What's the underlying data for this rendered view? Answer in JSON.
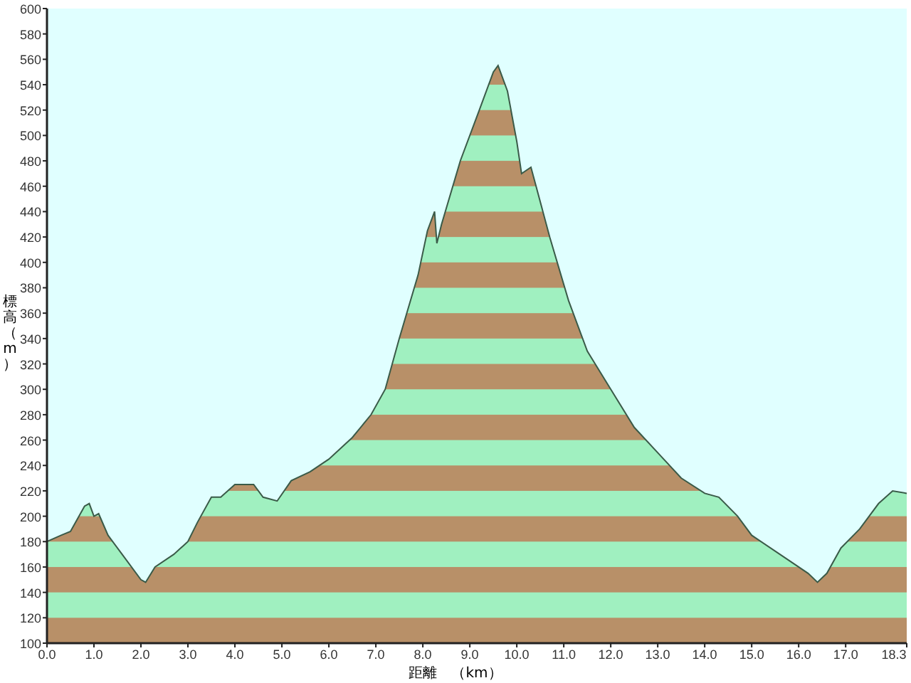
{
  "chart": {
    "chart_data": {
      "type": "area",
      "xlabel": "距離　（km）",
      "ylabel": "標高（m）",
      "x": [
        0,
        0.3,
        0.5,
        0.8,
        0.9,
        1.0,
        1.1,
        1.3,
        1.6,
        2.0,
        2.1,
        2.3,
        2.7,
        3.0,
        3.2,
        3.5,
        3.7,
        4.0,
        4.4,
        4.6,
        4.9,
        5.2,
        5.6,
        6.0,
        6.5,
        6.9,
        7.2,
        7.5,
        7.9,
        8.1,
        8.25,
        8.3,
        8.4,
        8.8,
        9.2,
        9.5,
        9.6,
        9.8,
        10.0,
        10.1,
        10.3,
        10.7,
        11.1,
        11.5,
        12.0,
        12.5,
        13.0,
        13.5,
        14.0,
        14.3,
        14.7,
        15.0,
        15.6,
        16.2,
        16.4,
        16.6,
        16.9,
        17.3,
        17.7,
        18.0,
        18.3
      ],
      "series": [
        {
          "color": "#3a5a48",
          "values": [
            180,
            185,
            188,
            208,
            210,
            200,
            202,
            185,
            170,
            150,
            148,
            160,
            170,
            180,
            195,
            215,
            215,
            225,
            225,
            215,
            212,
            228,
            235,
            245,
            262,
            280,
            300,
            340,
            390,
            425,
            440,
            415,
            430,
            480,
            520,
            550,
            555,
            535,
            495,
            470,
            475,
            420,
            370,
            330,
            300,
            270,
            250,
            230,
            218,
            215,
            200,
            185,
            170,
            155,
            148,
            155,
            175,
            190,
            210,
            220,
            218
          ]
        }
      ],
      "xlim": [
        0,
        18.3
      ],
      "ylim": [
        100,
        600
      ],
      "xticks": [
        {
          "value": 0,
          "label": "0.0"
        },
        {
          "value": 1,
          "label": "1.0"
        },
        {
          "value": 2,
          "label": "2.0"
        },
        {
          "value": 3,
          "label": "3.0"
        },
        {
          "value": 4,
          "label": "4.0"
        },
        {
          "value": 5,
          "label": "5.0"
        },
        {
          "value": 6,
          "label": "6.0"
        },
        {
          "value": 7,
          "label": "7.0"
        },
        {
          "value": 8,
          "label": "8.0"
        },
        {
          "value": 9,
          "label": "9.0"
        },
        {
          "value": 10,
          "label": "10.0"
        },
        {
          "value": 11,
          "label": "11.0"
        },
        {
          "value": 12,
          "label": "12.0"
        },
        {
          "value": 13,
          "label": "13.0"
        },
        {
          "value": 14,
          "label": "14.0"
        },
        {
          "value": 15,
          "label": "15.0"
        },
        {
          "value": 16,
          "label": "16.0"
        },
        {
          "value": 17,
          "label": "17.0"
        },
        {
          "value": 18.3,
          "label": "18.3"
        }
      ],
      "yticks": [
        100,
        120,
        140,
        160,
        180,
        200,
        220,
        240,
        260,
        280,
        300,
        320,
        340,
        360,
        380,
        400,
        420,
        440,
        460,
        480,
        500,
        520,
        540,
        560,
        580,
        600
      ]
    }
  }
}
